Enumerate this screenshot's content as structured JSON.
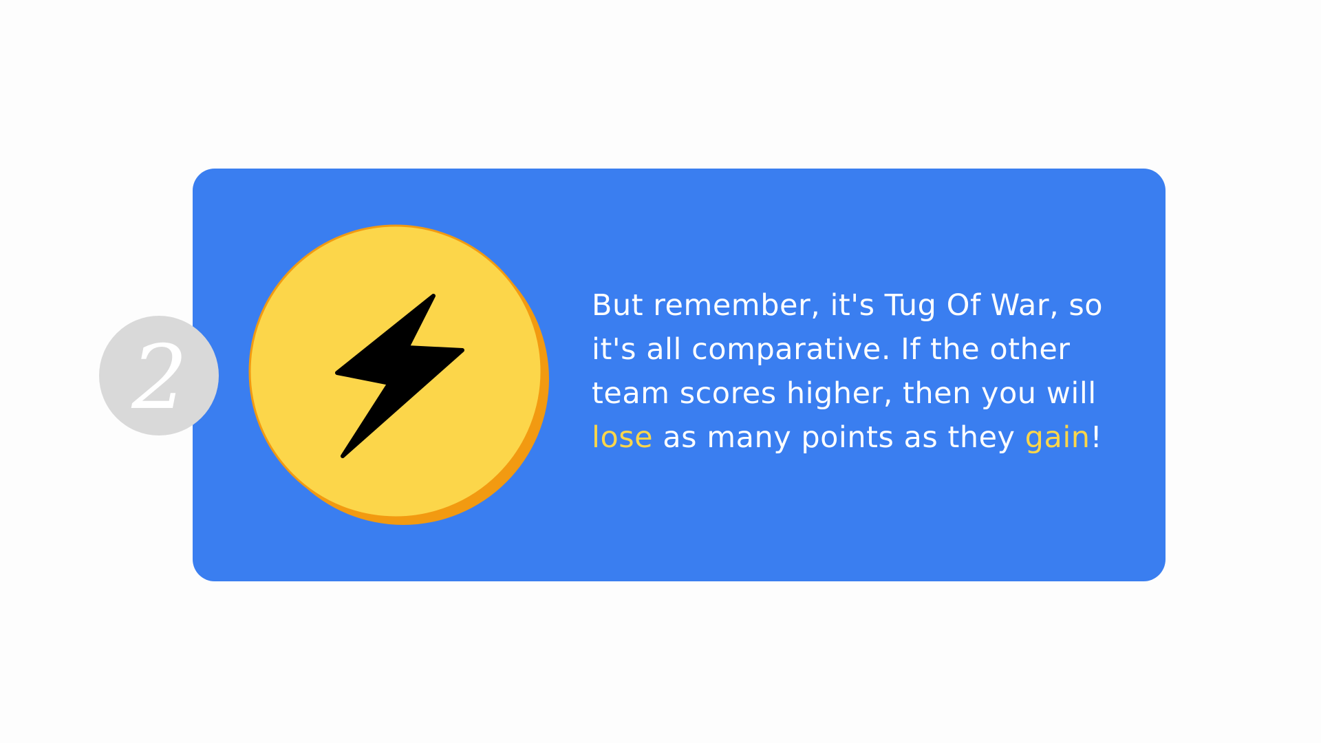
{
  "step": {
    "number": "2"
  },
  "icon": {
    "name": "lightning-bolt-icon"
  },
  "message": {
    "line1": "But remember, it's Tug Of War, so",
    "line2": "it's all comparative. If the other",
    "line3": "team scores higher, then you will",
    "line4_highlight1": "lose",
    "line4_mid": " as many points as they ",
    "line4_highlight2": "gain",
    "line4_end": "!"
  },
  "colors": {
    "background": "#fdfdfd",
    "card": "#3a7ef0",
    "coin_face": "#fcd64a",
    "coin_rim": "#f29a11",
    "highlight": "#fcd64a",
    "badge": "#d9d9d9"
  }
}
